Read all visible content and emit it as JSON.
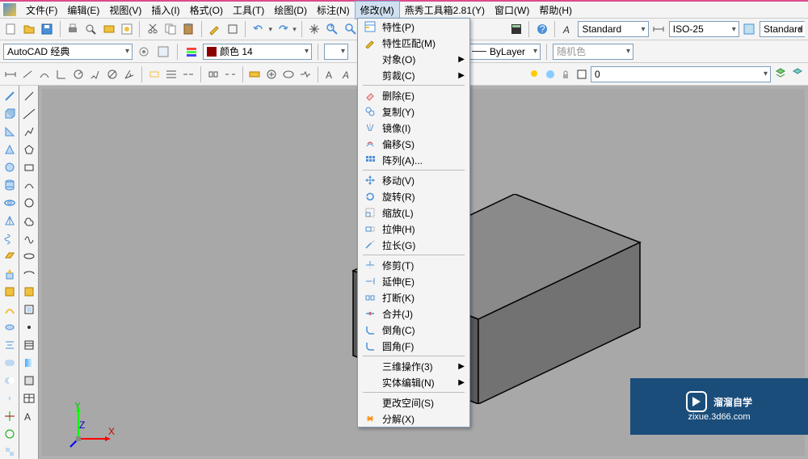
{
  "menubar": {
    "items": [
      {
        "label": "文件(F)"
      },
      {
        "label": "编辑(E)"
      },
      {
        "label": "视图(V)"
      },
      {
        "label": "插入(I)"
      },
      {
        "label": "格式(O)"
      },
      {
        "label": "工具(T)"
      },
      {
        "label": "绘图(D)"
      },
      {
        "label": "标注(N)"
      },
      {
        "label": "修改(M)"
      },
      {
        "label": "燕秀工具箱2.81(Y)"
      },
      {
        "label": "窗口(W)"
      },
      {
        "label": "帮助(H)"
      }
    ],
    "active_index": 8
  },
  "workspace_combo": "AutoCAD 经典",
  "color_combo": "颜色 14",
  "color_hex": "#8B0000",
  "linetype_combo": "ByLayer",
  "lineweight_combo": "",
  "random_color": "随机色",
  "text_style": "Standard",
  "dim_style": "ISO-25",
  "table_style": "Standard",
  "layer_combo": "0",
  "iso_label": "ISO",
  "dropdown": {
    "groups": [
      [
        {
          "icon": "properties",
          "label": "特性(P)"
        },
        {
          "icon": "match",
          "label": "特性匹配(M)"
        },
        {
          "icon": "",
          "label": "对象(O)",
          "submenu": true
        },
        {
          "icon": "",
          "label": "剪裁(C)",
          "submenu": true
        }
      ],
      [
        {
          "icon": "erase",
          "label": "删除(E)"
        },
        {
          "icon": "copy",
          "label": "复制(Y)"
        },
        {
          "icon": "mirror",
          "label": "镜像(I)"
        },
        {
          "icon": "offset",
          "label": "偏移(S)"
        },
        {
          "icon": "array",
          "label": "阵列(A)..."
        }
      ],
      [
        {
          "icon": "move",
          "label": "移动(V)"
        },
        {
          "icon": "rotate",
          "label": "旋转(R)"
        },
        {
          "icon": "scale",
          "label": "缩放(L)"
        },
        {
          "icon": "stretch",
          "label": "拉伸(H)"
        },
        {
          "icon": "lengthen",
          "label": "拉长(G)"
        }
      ],
      [
        {
          "icon": "trim",
          "label": "修剪(T)"
        },
        {
          "icon": "extend",
          "label": "延伸(E)"
        },
        {
          "icon": "break",
          "label": "打断(K)"
        },
        {
          "icon": "join",
          "label": "合并(J)"
        },
        {
          "icon": "chamfer",
          "label": "倒角(C)"
        },
        {
          "icon": "fillet",
          "label": "圆角(F)"
        }
      ],
      [
        {
          "icon": "",
          "label": "三维操作(3)",
          "submenu": true
        },
        {
          "icon": "",
          "label": "实体编辑(N)",
          "submenu": true
        }
      ],
      [
        {
          "icon": "",
          "label": "更改空间(S)"
        },
        {
          "icon": "explode",
          "label": "分解(X)"
        }
      ]
    ]
  },
  "watermark": {
    "main": "溜溜自学",
    "sub": "zixue.3d66.com"
  }
}
